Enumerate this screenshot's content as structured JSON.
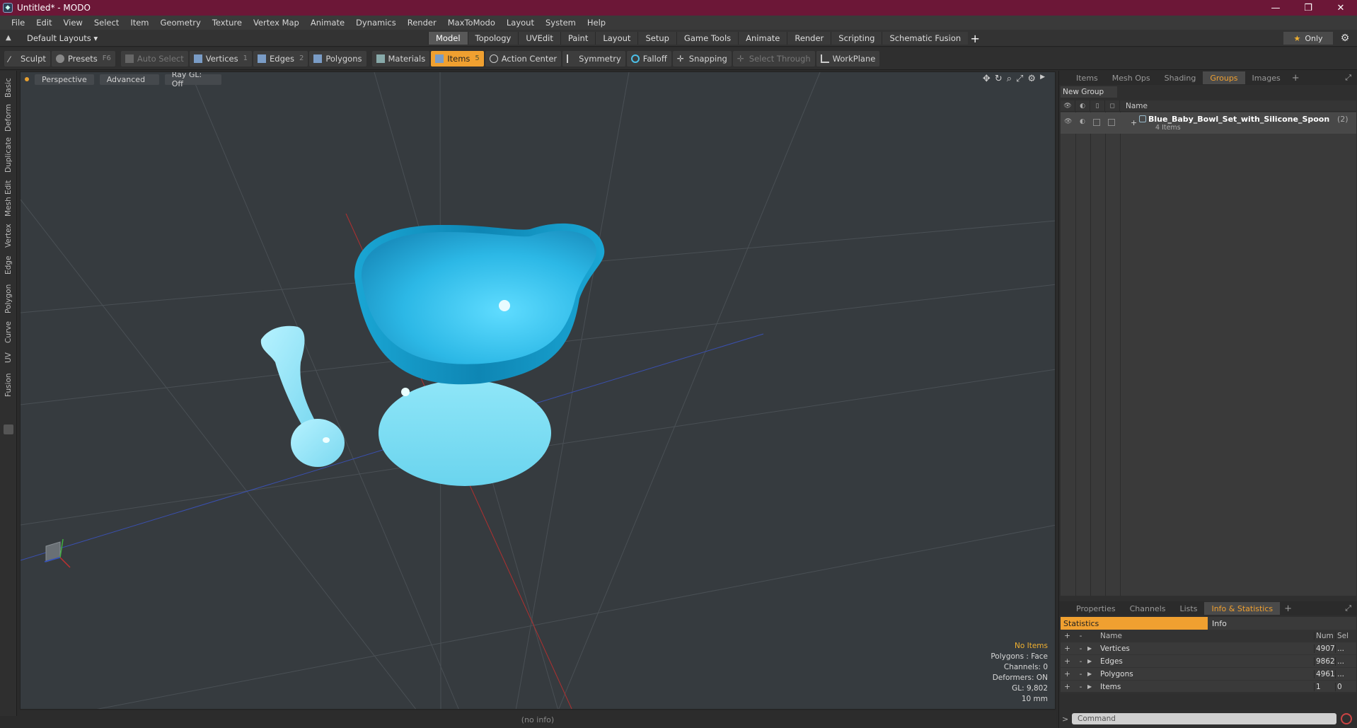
{
  "window": {
    "title": "Untitled* - MODO",
    "min": "—",
    "max": "❐",
    "close": "✕"
  },
  "menu": [
    "File",
    "Edit",
    "View",
    "Select",
    "Item",
    "Geometry",
    "Texture",
    "Vertex Map",
    "Animate",
    "Dynamics",
    "Render",
    "MaxToModo",
    "Layout",
    "System",
    "Help"
  ],
  "layout_dropdown": "Default Layouts ▾",
  "mode_tabs": [
    "Model",
    "Topology",
    "UVEdit",
    "Paint",
    "Layout",
    "Setup",
    "Game Tools",
    "Animate",
    "Render",
    "Scripting",
    "Schematic Fusion"
  ],
  "mode_plus": "+",
  "only_label": "Only",
  "toolbar": {
    "sculpt": "Sculpt",
    "presets": "Presets",
    "presets_key": "F6",
    "auto_select": "Auto Select",
    "vertices": "Vertices",
    "vertices_key": "1",
    "edges": "Edges",
    "edges_key": "2",
    "polygons": "Polygons",
    "materials": "Materials",
    "items": "Items",
    "items_key": "5",
    "action_center": "Action Center",
    "symmetry": "Symmetry",
    "falloff": "Falloff",
    "snapping": "Snapping",
    "select_through": "Select Through",
    "workplane": "WorkPlane"
  },
  "left_tabs": [
    "Basic",
    "Deform",
    "Duplicate",
    "Mesh Edit",
    "Vertex",
    "Edge",
    "Polygon",
    "Curve",
    "UV",
    "Fusion"
  ],
  "viewport": {
    "perspective": "Perspective",
    "advanced": "Advanced",
    "raygl": "Ray GL: Off",
    "info": {
      "no_items": "No Items",
      "polygons": "Polygons : Face",
      "channels": "Channels: 0",
      "deformers": "Deformers: ON",
      "gl": "GL: 9,802",
      "scale": "10 mm"
    }
  },
  "status": "(no info)",
  "right_tabs_top": [
    "Items",
    "Mesh Ops",
    "Shading",
    "Groups",
    "Images"
  ],
  "groups": {
    "new_group": "New Group",
    "col_name": "Name",
    "row_name": "Blue_Baby_Bowl_Set_with_Silicone_Spoon",
    "row_count": "(2)",
    "row_sub": "4 Items"
  },
  "right_tabs_bottom": [
    "Properties",
    "Channels",
    "Lists",
    "Info & Statistics"
  ],
  "stats": {
    "statistics_tab": "Statistics",
    "info_tab": "Info",
    "col_name": "Name",
    "col_num": "Num",
    "col_sel": "Sel",
    "rows": [
      {
        "name": "Vertices",
        "num": "4907",
        "sel": "..."
      },
      {
        "name": "Edges",
        "num": "9862",
        "sel": "..."
      },
      {
        "name": "Polygons",
        "num": "4961",
        "sel": "..."
      },
      {
        "name": "Items",
        "num": "1",
        "sel": "0"
      }
    ]
  },
  "command_placeholder": "Command",
  "colors": {
    "accent": "#f0a030",
    "titlebar": "#6c1737",
    "bowl": "#3cc8ee"
  }
}
